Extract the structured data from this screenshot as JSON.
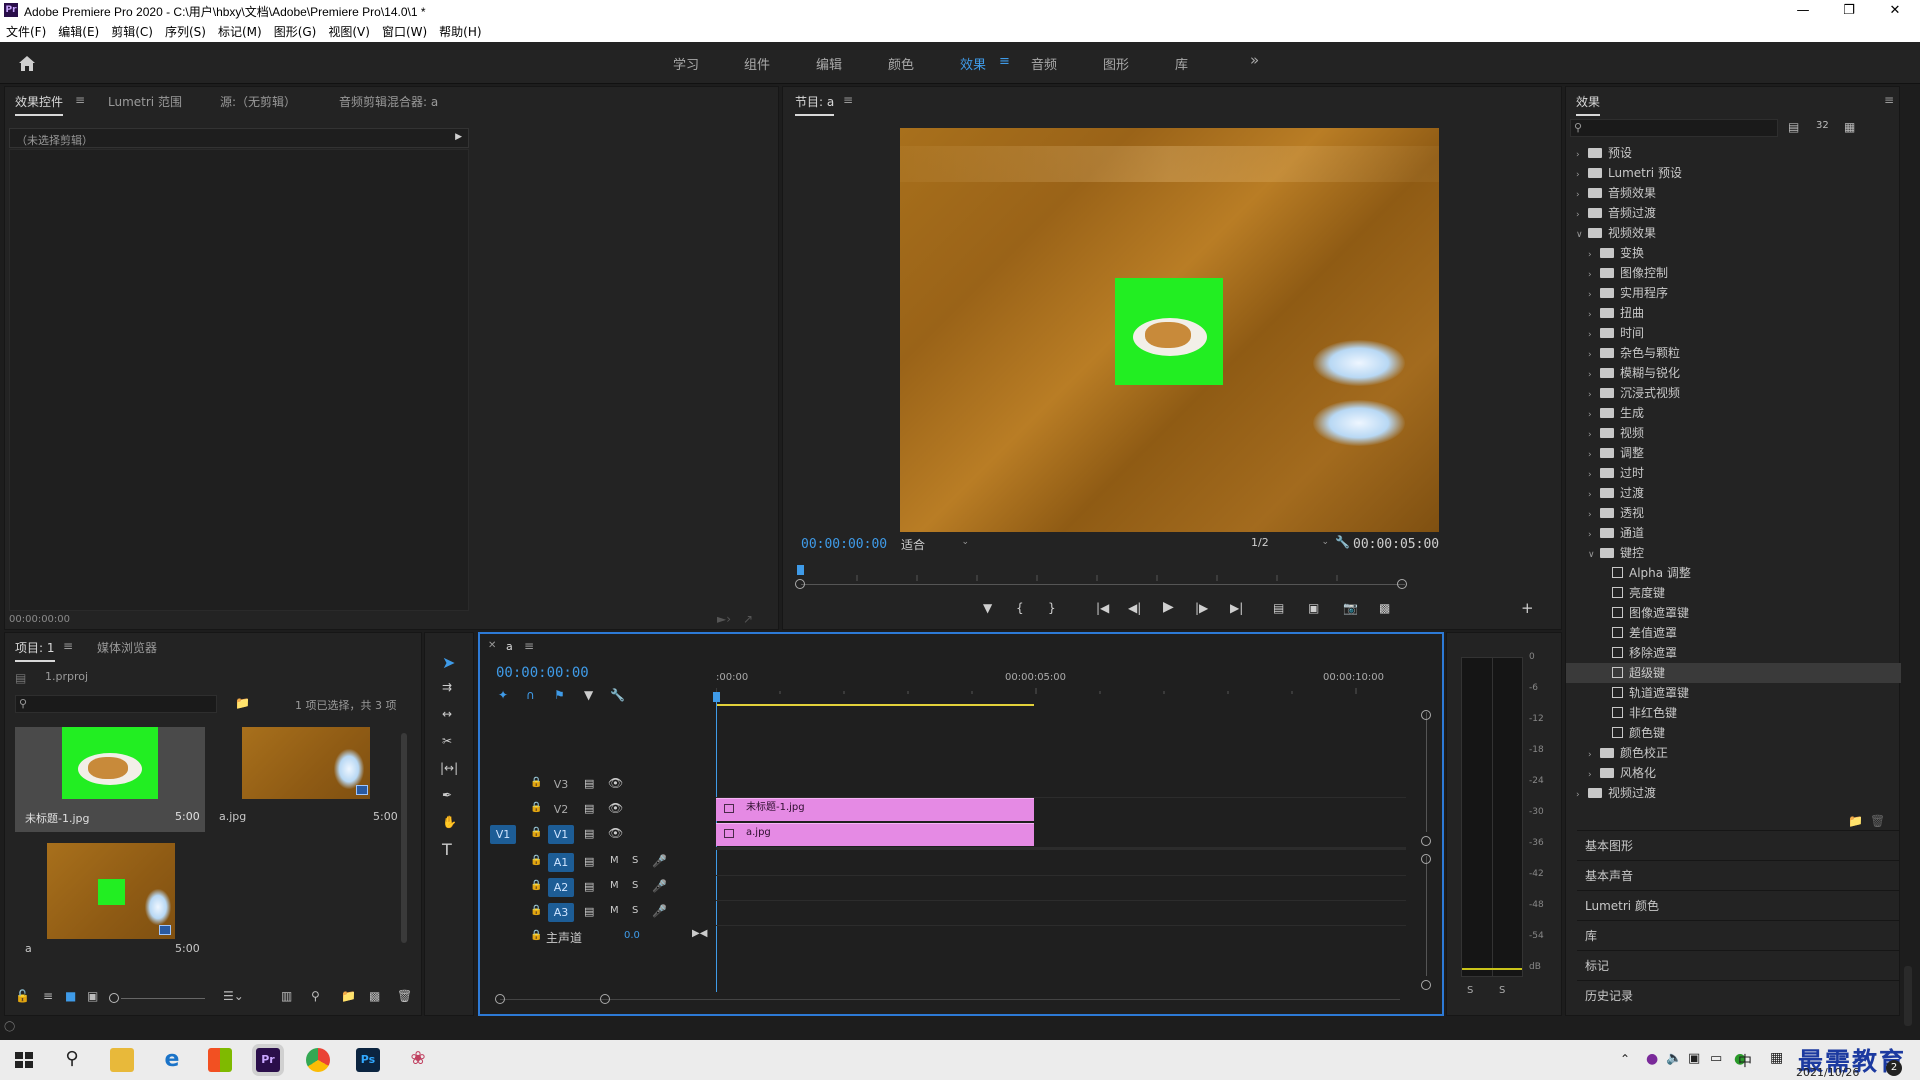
{
  "window": {
    "title": "Adobe Premiere Pro 2020 - C:\\用户\\hbxy\\文档\\Adobe\\Premiere Pro\\14.0\\1 *",
    "app_icon_text": "Pr"
  },
  "menu": [
    "文件(F)",
    "编辑(E)",
    "剪辑(C)",
    "序列(S)",
    "标记(M)",
    "图形(G)",
    "视图(V)",
    "窗口(W)",
    "帮助(H)"
  ],
  "workspace_tabs": [
    "学习",
    "组件",
    "编辑",
    "颜色",
    "效果",
    "音频",
    "图形",
    "库"
  ],
  "workspace_active": "效果",
  "workspace_more": "»",
  "source_panel": {
    "tabs": [
      "效果控件",
      "Lumetri 范围",
      "源:（无剪辑）",
      "音频剪辑混合器: a"
    ],
    "clip_label": "（未选择剪辑）",
    "timecode": "00:00:00:00"
  },
  "program_monitor": {
    "title": "节目: a",
    "timecode_current": "00:00:00:00",
    "fit": "适合",
    "resolution": "1/2",
    "timecode_duration": "00:00:05:00",
    "playhead_fraction": 0.0
  },
  "project_panel": {
    "tabs": [
      "项目: 1",
      "媒体浏览器"
    ],
    "project_file": "1.prproj",
    "status": "1 项已选择，共 3 项",
    "items": [
      {
        "name": "未标题-1.jpg",
        "duration": "5:00",
        "selected": true
      },
      {
        "name": "a.jpg",
        "duration": "5:00",
        "selected": false
      },
      {
        "name": "a",
        "duration": "5:00",
        "selected": false
      }
    ]
  },
  "timeline": {
    "sequence": "a",
    "timecode": "00:00:00:00",
    "ruler": [
      ":00:00",
      "00:00:05:00",
      "00:00:10:00"
    ],
    "video_tracks": [
      {
        "name": "V3",
        "source": ""
      },
      {
        "name": "V2",
        "source": ""
      },
      {
        "name": "V1",
        "source": "V1"
      }
    ],
    "audio_tracks": [
      {
        "name": "A1",
        "m": "M",
        "s": "S"
      },
      {
        "name": "A2",
        "m": "M",
        "s": "S"
      },
      {
        "name": "A3",
        "m": "M",
        "s": "S"
      }
    ],
    "master": {
      "label": "主声道",
      "value": "0.0"
    },
    "clips": [
      {
        "track": "V2",
        "name": "未标题-1.jpg"
      },
      {
        "track": "V1",
        "name": "a.jpg"
      }
    ]
  },
  "audio_meter": {
    "scale": [
      "0",
      "-6",
      "-12",
      "-18",
      "-24",
      "-30",
      "-36",
      "-42",
      "-48",
      "-54",
      "dB"
    ],
    "solo": [
      "S",
      "S"
    ]
  },
  "effects_panel": {
    "title": "效果",
    "search_placeholder": "",
    "tree": [
      {
        "label": "预设",
        "level": 0,
        "type": "folder",
        "open": false,
        "special": true
      },
      {
        "label": "Lumetri 预设",
        "level": 0,
        "type": "folder",
        "open": false,
        "special": true
      },
      {
        "label": "音频效果",
        "level": 0,
        "type": "folder",
        "open": false
      },
      {
        "label": "音频过渡",
        "level": 0,
        "type": "folder",
        "open": false
      },
      {
        "label": "视频效果",
        "level": 0,
        "type": "folder",
        "open": true
      },
      {
        "label": "变换",
        "level": 1,
        "type": "folder",
        "open": false
      },
      {
        "label": "图像控制",
        "level": 1,
        "type": "folder",
        "open": false
      },
      {
        "label": "实用程序",
        "level": 1,
        "type": "folder",
        "open": false
      },
      {
        "label": "扭曲",
        "level": 1,
        "type": "folder",
        "open": false
      },
      {
        "label": "时间",
        "level": 1,
        "type": "folder",
        "open": false
      },
      {
        "label": "杂色与颗粒",
        "level": 1,
        "type": "folder",
        "open": false
      },
      {
        "label": "模糊与锐化",
        "level": 1,
        "type": "folder",
        "open": false
      },
      {
        "label": "沉浸式视频",
        "level": 1,
        "type": "folder",
        "open": false
      },
      {
        "label": "生成",
        "level": 1,
        "type": "folder",
        "open": false
      },
      {
        "label": "视频",
        "level": 1,
        "type": "folder",
        "open": false
      },
      {
        "label": "调整",
        "level": 1,
        "type": "folder",
        "open": false
      },
      {
        "label": "过时",
        "level": 1,
        "type": "folder",
        "open": false
      },
      {
        "label": "过渡",
        "level": 1,
        "type": "folder",
        "open": false
      },
      {
        "label": "透视",
        "level": 1,
        "type": "folder",
        "open": false
      },
      {
        "label": "通道",
        "level": 1,
        "type": "folder",
        "open": false
      },
      {
        "label": "键控",
        "level": 1,
        "type": "folder",
        "open": true
      },
      {
        "label": "Alpha 调整",
        "level": 2,
        "type": "effect"
      },
      {
        "label": "亮度键",
        "level": 2,
        "type": "effect"
      },
      {
        "label": "图像遮罩键",
        "level": 2,
        "type": "effect"
      },
      {
        "label": "差值遮罩",
        "level": 2,
        "type": "effect"
      },
      {
        "label": "移除遮罩",
        "level": 2,
        "type": "effect"
      },
      {
        "label": "超级键",
        "level": 2,
        "type": "effect",
        "selected": true
      },
      {
        "label": "轨道遮罩键",
        "level": 2,
        "type": "effect"
      },
      {
        "label": "非红色键",
        "level": 2,
        "type": "effect"
      },
      {
        "label": "颜色键",
        "level": 2,
        "type": "effect"
      },
      {
        "label": "颜色校正",
        "level": 1,
        "type": "folder",
        "open": false
      },
      {
        "label": "风格化",
        "level": 1,
        "type": "folder",
        "open": false
      },
      {
        "label": "视频过渡",
        "level": 0,
        "type": "folder",
        "open": false
      }
    ],
    "sections": [
      "基本图形",
      "基本声音",
      "Lumetri 颜色",
      "库",
      "标记",
      "历史记录"
    ]
  },
  "taskbar": {
    "tray_lang": "中",
    "date": "2021/10/26",
    "watermark": "最需教育",
    "apps": [
      "windows-start",
      "search",
      "file-explorer",
      "edge",
      "store",
      "premiere",
      "chrome",
      "photoshop",
      "paint"
    ],
    "notification_badge": "2"
  },
  "colors": {
    "accent": "#3f9be8",
    "clip": "#e58ae4",
    "green_screen": "#22ee22",
    "wood": "#a8701c"
  }
}
